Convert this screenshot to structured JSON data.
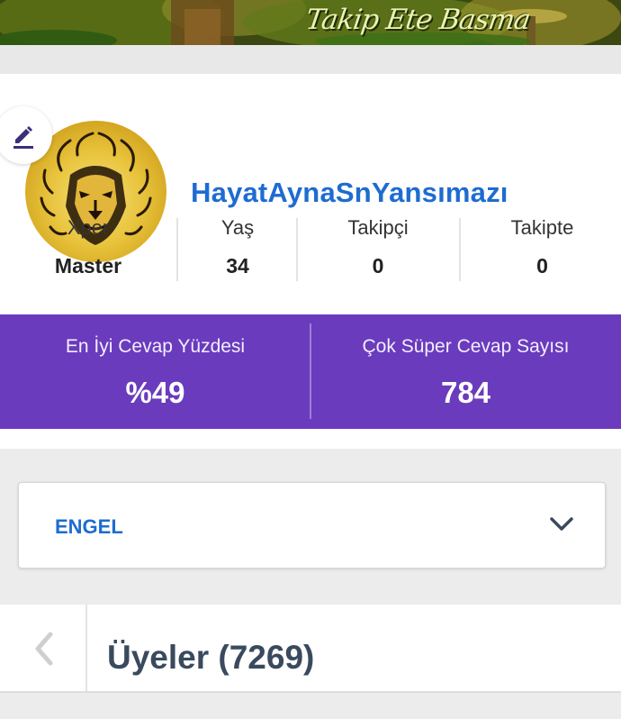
{
  "cover": {
    "text": "Takip Ete Basma"
  },
  "profile": {
    "username": "HayatAynaSnYansımazı",
    "avatar_icon": "lion-avatar-icon",
    "edit_icon": "pencil-icon",
    "stats": [
      {
        "label": "Xper",
        "value": "Master"
      },
      {
        "label": "Yaş",
        "value": "34"
      },
      {
        "label": "Takipçi",
        "value": "0"
      },
      {
        "label": "Takipte",
        "value": "0"
      }
    ]
  },
  "highlights": {
    "best_answer": {
      "label": "En İyi Cevap Yüzdesi",
      "value": "%49"
    },
    "super_answer": {
      "label": "Çok Süper Cevap Sayısı",
      "value": "784"
    }
  },
  "dropdown": {
    "label": "ENGEL",
    "icon": "chevron-down-icon"
  },
  "members": {
    "title": "Üyeler (7269)",
    "back_icon": "chevron-left-icon"
  },
  "colors": {
    "accent_blue": "#1e6cd0",
    "purple": "#6a3bbd",
    "title_slate": "#3a4a5e"
  }
}
